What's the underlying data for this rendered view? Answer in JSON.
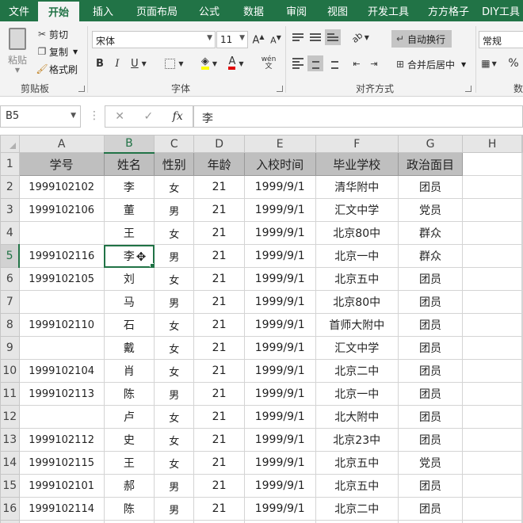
{
  "tabs": [
    {
      "label": "文件",
      "width": 48
    },
    {
      "label": "开始",
      "width": 52,
      "active": true
    },
    {
      "label": "插入",
      "width": 60
    },
    {
      "label": "页面布局",
      "width": 76
    },
    {
      "label": "公式",
      "width": 56
    },
    {
      "label": "数据",
      "width": 56
    },
    {
      "label": "审阅",
      "width": 52
    },
    {
      "label": "视图",
      "width": 52
    },
    {
      "label": "开发工具",
      "width": 76
    },
    {
      "label": "方方格子",
      "width": 76
    },
    {
      "label": "DIY工具",
      "width": 56
    }
  ],
  "ribbon": {
    "clipboard": {
      "paste": "粘贴",
      "cut": "剪切",
      "copy": "复制",
      "format_painter": "格式刷",
      "label": "剪贴板"
    },
    "font": {
      "name": "宋体",
      "size": "11",
      "bold": "B",
      "italic": "I",
      "underline": "U",
      "phonetic": "wén",
      "label": "字体"
    },
    "alignment": {
      "wrap": "自动换行",
      "merge": "合并后居中",
      "label": "对齐方式"
    },
    "number": {
      "format": "常规",
      "percent": "%",
      "label": "数"
    }
  },
  "formula_bar": {
    "name_box": "B5",
    "fx": "fx",
    "content": "李"
  },
  "columns": [
    "A",
    "B",
    "C",
    "D",
    "E",
    "F",
    "G",
    "H"
  ],
  "table_headers": [
    "学号",
    "姓名",
    "性别",
    "年龄",
    "入校时间",
    "毕业学校",
    "政治面目"
  ],
  "rows": [
    {
      "n": "2",
      "cells": [
        "1999102102",
        "李",
        "女",
        "21",
        "1999/9/1",
        "清华附中",
        "团员"
      ]
    },
    {
      "n": "3",
      "cells": [
        "1999102106",
        "董",
        "男",
        "21",
        "1999/9/1",
        "汇文中学",
        "党员"
      ]
    },
    {
      "n": "4",
      "cells": [
        "",
        "王",
        "女",
        "21",
        "1999/9/1",
        "北京80中",
        "群众"
      ]
    },
    {
      "n": "5",
      "cells": [
        "1999102116",
        "李",
        "男",
        "21",
        "1999/9/1",
        "北京一中",
        "群众"
      ]
    },
    {
      "n": "6",
      "cells": [
        "1999102105",
        "刘",
        "女",
        "21",
        "1999/9/1",
        "北京五中",
        "团员"
      ]
    },
    {
      "n": "7",
      "cells": [
        "",
        "马",
        "男",
        "21",
        "1999/9/1",
        "北京80中",
        "团员"
      ]
    },
    {
      "n": "8",
      "cells": [
        "1999102110",
        "石",
        "女",
        "21",
        "1999/9/1",
        "首师大附中",
        "团员"
      ]
    },
    {
      "n": "9",
      "cells": [
        "",
        "戴",
        "女",
        "21",
        "1999/9/1",
        "汇文中学",
        "团员"
      ]
    },
    {
      "n": "10",
      "cells": [
        "1999102104",
        "肖",
        "女",
        "21",
        "1999/9/1",
        "北京二中",
        "团员"
      ]
    },
    {
      "n": "11",
      "cells": [
        "1999102113",
        "陈",
        "男",
        "21",
        "1999/9/1",
        "北京一中",
        "团员"
      ]
    },
    {
      "n": "12",
      "cells": [
        "",
        "卢",
        "女",
        "21",
        "1999/9/1",
        "北大附中",
        "团员"
      ]
    },
    {
      "n": "13",
      "cells": [
        "1999102112",
        "史",
        "女",
        "21",
        "1999/9/1",
        "北京23中",
        "团员"
      ]
    },
    {
      "n": "14",
      "cells": [
        "1999102115",
        "王",
        "女",
        "21",
        "1999/9/1",
        "北京五中",
        "党员"
      ]
    },
    {
      "n": "15",
      "cells": [
        "1999102101",
        "郝",
        "男",
        "21",
        "1999/9/1",
        "北京五中",
        "团员"
      ]
    },
    {
      "n": "16",
      "cells": [
        "1999102114",
        "陈",
        "男",
        "21",
        "1999/9/1",
        "北京二中",
        "团员"
      ]
    },
    {
      "n": "17",
      "cells": [
        "",
        "",
        "",
        "",
        "",
        "",
        ""
      ]
    }
  ],
  "selection": {
    "row": "5",
    "col": "B"
  }
}
